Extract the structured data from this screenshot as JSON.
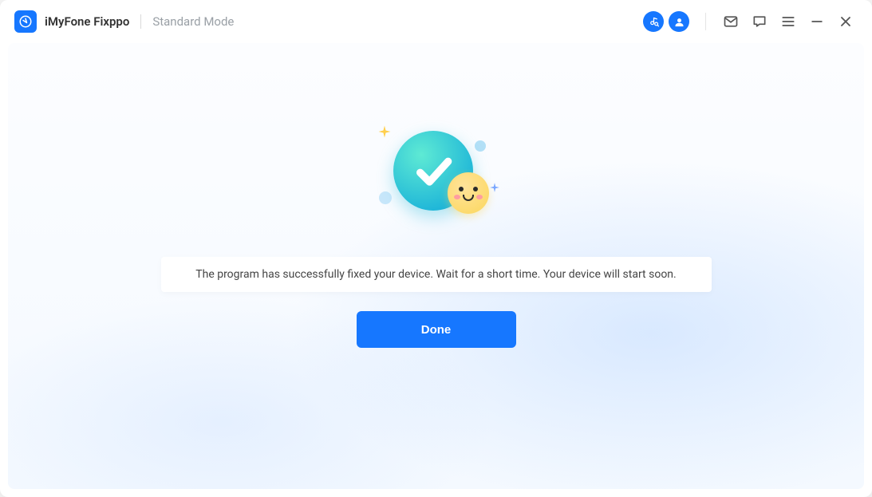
{
  "colors": {
    "accent": "#1677ff",
    "muted": "#9aa0a6"
  },
  "header": {
    "app_name": "iMyFone Fixppo",
    "mode": "Standard Mode",
    "icons": {
      "music": "music-search-icon",
      "account": "account-icon",
      "mail": "mail-icon",
      "feedback": "speech-bubble-icon",
      "menu": "menu-icon",
      "minimize": "minimize-icon",
      "close": "close-icon"
    }
  },
  "main": {
    "message": "The program has successfully fixed your device. Wait for a short time. Your device will start soon.",
    "done_label": "Done"
  }
}
